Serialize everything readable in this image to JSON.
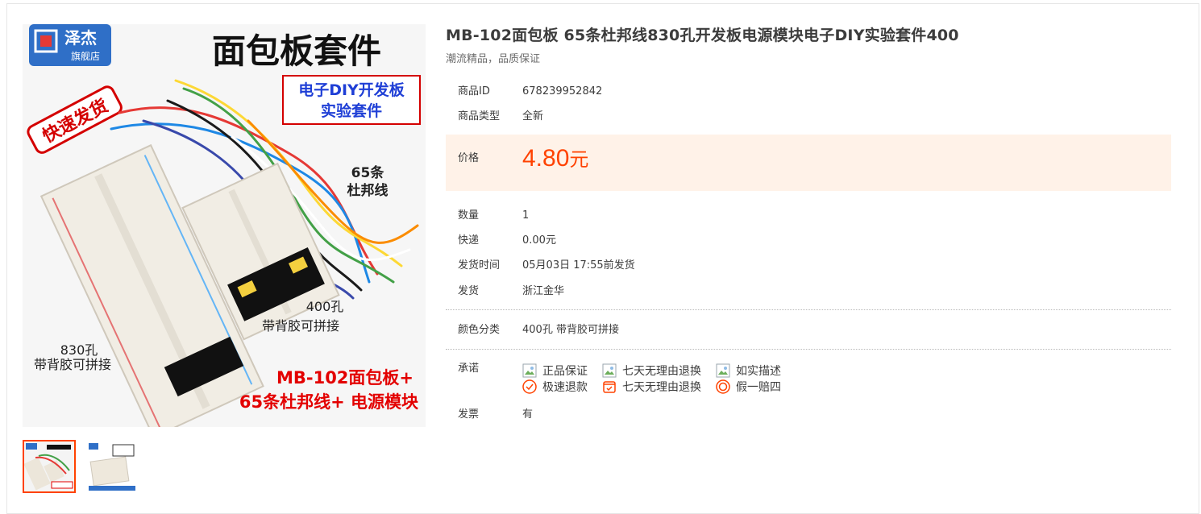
{
  "product": {
    "title": "MB-102面包板 65条杜邦线830孔开发板电源模块电子DIY实验套件400",
    "subtitle": "潮流精品，品质保证"
  },
  "image": {
    "brand_name": "泽杰",
    "brand_store": "旗舰店",
    "headline": "面包板套件",
    "sub_headline_1": "电子DIY开发板",
    "sub_headline_2": "实验套件",
    "stamp": "快速发货",
    "wire_label_1": "65条",
    "wire_label_2": "杜邦线",
    "small_board_label_1": "400孔",
    "small_board_label_2": "带背胶可拼接",
    "big_board_label_1": "830孔",
    "big_board_label_2": "带背胶可拼接",
    "footer_line_1": "MB-102面包板+",
    "footer_line_2": "65条杜邦线+ 电源模块"
  },
  "fields": {
    "id_label": "商品ID",
    "id_value": "678239952842",
    "type_label": "商品类型",
    "type_value": "全新",
    "price_label": "价格",
    "price_value": "4.80",
    "price_unit": "元",
    "qty_label": "数量",
    "qty_value": "1",
    "shipping_label": "快递",
    "shipping_value": "0.00元",
    "ship_time_label": "发货时间",
    "ship_time_value": "05月03日 17:55前发货",
    "origin_label": "发货",
    "origin_value": "浙江金华",
    "color_label": "颜色分类",
    "color_value": "400孔 带背胶可拼接",
    "promise_label": "承诺",
    "invoice_label": "发票",
    "invoice_value": "有"
  },
  "promises": [
    {
      "label": "正品保证",
      "icon": "image-placeholder-icon"
    },
    {
      "label": "七天无理由退换",
      "icon": "image-placeholder-icon"
    },
    {
      "label": "如实描述",
      "icon": "image-placeholder-icon"
    },
    {
      "label": "极速退款",
      "icon": "check-circle-icon"
    },
    {
      "label": "七天无理由退换",
      "icon": "calendar-check-icon"
    },
    {
      "label": "假一赔四",
      "icon": "badge-circle-icon"
    }
  ],
  "colors": {
    "price": "#ff4200",
    "price_bg": "#fff2e8",
    "active_thumb": "#ff4200",
    "brand_blue": "#2f6fc7",
    "footer_red": "#e30000"
  }
}
